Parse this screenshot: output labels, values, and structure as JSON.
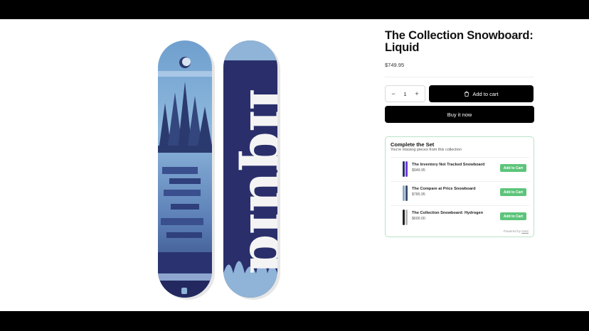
{
  "product": {
    "title": "The Collection Snowboard: Liquid",
    "price": "$749.95"
  },
  "purchase": {
    "quantity": "1",
    "decrease_symbol": "−",
    "increase_symbol": "+",
    "add_to_cart_label": "Add to cart",
    "buy_now_label": "Buy it now"
  },
  "complete_set": {
    "title": "Complete the Set",
    "subtitle": "You're missing pieces from this collection",
    "items": [
      {
        "name": "The Inventory Not Tracked Snowboard",
        "price": "$949.95",
        "button": "Add to Cart",
        "color": "#6b3fd4"
      },
      {
        "name": "The Compare at Price Snowboard",
        "price": "$785.95",
        "button": "Add to Cart",
        "color": "#8fa9c4"
      },
      {
        "name": "The Collection Snowboard: Hydrogen",
        "price": "$600.00",
        "button": "Add to Cart",
        "color": "#222222"
      }
    ],
    "powered_prefix": "Powered by",
    "powered_brand": "Getz"
  },
  "colors": {
    "button_bg": "#000000",
    "accent_green": "#5cc47a",
    "set_border": "#b8e2c5",
    "board_light_blue": "#8fb4d8",
    "board_navy": "#2a2f6b"
  }
}
